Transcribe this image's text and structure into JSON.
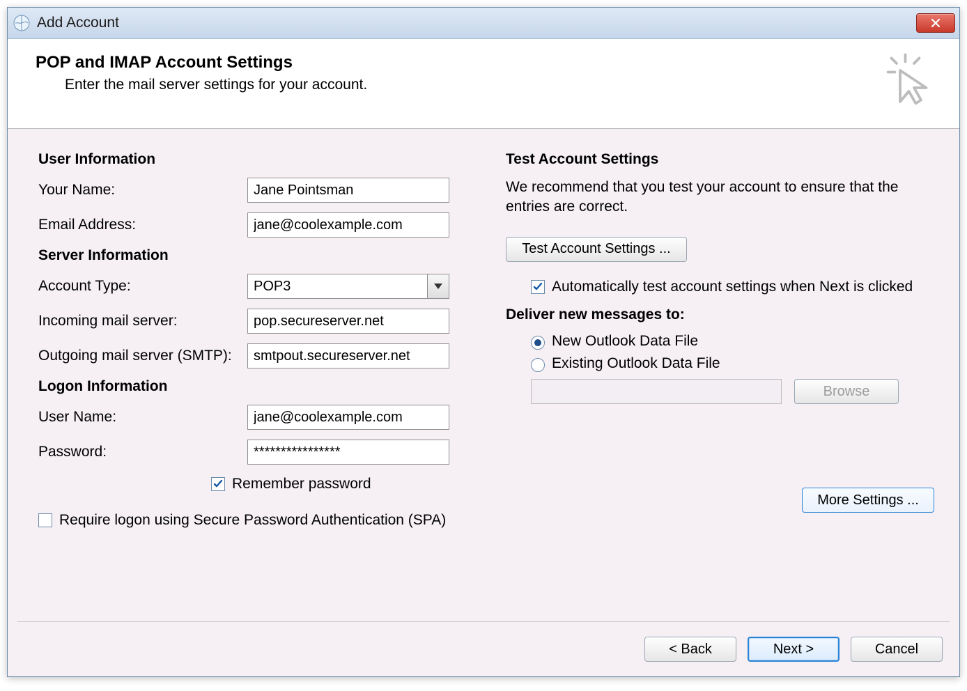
{
  "window": {
    "title": "Add Account"
  },
  "header": {
    "title": "POP and IMAP Account Settings",
    "subtitle": "Enter the mail server settings for your account."
  },
  "left": {
    "sect_user": "User Information",
    "sect_server": "Server Information",
    "sect_logon": "Logon Information",
    "labels": {
      "your_name": "Your Name:",
      "email": "Email Address:",
      "account_type": "Account Type:",
      "incoming": "Incoming mail server:",
      "outgoing": "Outgoing mail server (SMTP):",
      "user_name": "User Name:",
      "password": "Password:"
    },
    "values": {
      "your_name": "Jane Pointsman",
      "email": "jane@coolexample.com",
      "account_type": "POP3",
      "incoming": "pop.secureserver.net",
      "outgoing": "smtpout.secureserver.net",
      "user_name": "jane@coolexample.com",
      "password": "****************"
    },
    "remember_password": {
      "label": "Remember password",
      "checked": true
    },
    "spa": {
      "label": "Require logon using Secure Password Authentication (SPA)",
      "checked": false
    }
  },
  "right": {
    "sect_test": "Test Account Settings",
    "test_desc": "We recommend that you test your account to ensure that the entries are correct.",
    "test_button": "Test Account Settings ...",
    "auto_test": {
      "label": "Automatically test account settings when Next is clicked",
      "checked": true
    },
    "deliver_label": "Deliver new messages to:",
    "deliver_options": {
      "new_file": "New Outlook Data File",
      "existing_file": "Existing Outlook Data File",
      "selected": "new_file",
      "existing_path": ""
    },
    "browse": "Browse",
    "more_settings": "More Settings ..."
  },
  "footer": {
    "back": "< Back",
    "next": "Next >",
    "cancel": "Cancel"
  }
}
